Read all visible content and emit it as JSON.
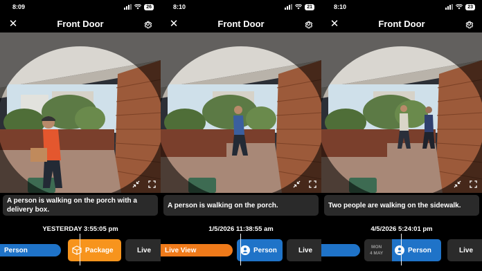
{
  "panels": [
    {
      "status_time": "8:09",
      "battery": "26",
      "title": "Front Door",
      "caption": "A person is walking on the porch with a delivery box.",
      "timestamp": "YESTERDAY 3:55:05 pm",
      "events": {
        "left": "Person",
        "middle": "Package",
        "right": "Live"
      }
    },
    {
      "status_time": "8:10",
      "battery": "21",
      "title": "Front Door",
      "caption": "A person is walking on the porch.",
      "timestamp": "1/5/2026 11:38:55 am",
      "events": {
        "left": "Live View",
        "middle": "Person",
        "right": "Live"
      }
    },
    {
      "status_time": "8:10",
      "battery": "23",
      "title": "Front Door",
      "caption": "Two people are walking on the sidewalk.",
      "timestamp": "4/5/2026 5:24:01 pm",
      "events": {
        "date_day": "MON",
        "date_date": "4 MAY",
        "middle": "Person",
        "right": "Live"
      }
    }
  ],
  "colors": {
    "event_blue": "#1f73c8",
    "package_orange": "#f7941d",
    "live_orange": "#ef7a1a",
    "chip_dark": "#2b2b2b"
  },
  "icons": [
    "close-icon",
    "gear-icon",
    "zoom-out-icon",
    "fullscreen-icon",
    "person-icon",
    "package-icon",
    "signal-icon",
    "wifi-icon",
    "battery-icon"
  ]
}
